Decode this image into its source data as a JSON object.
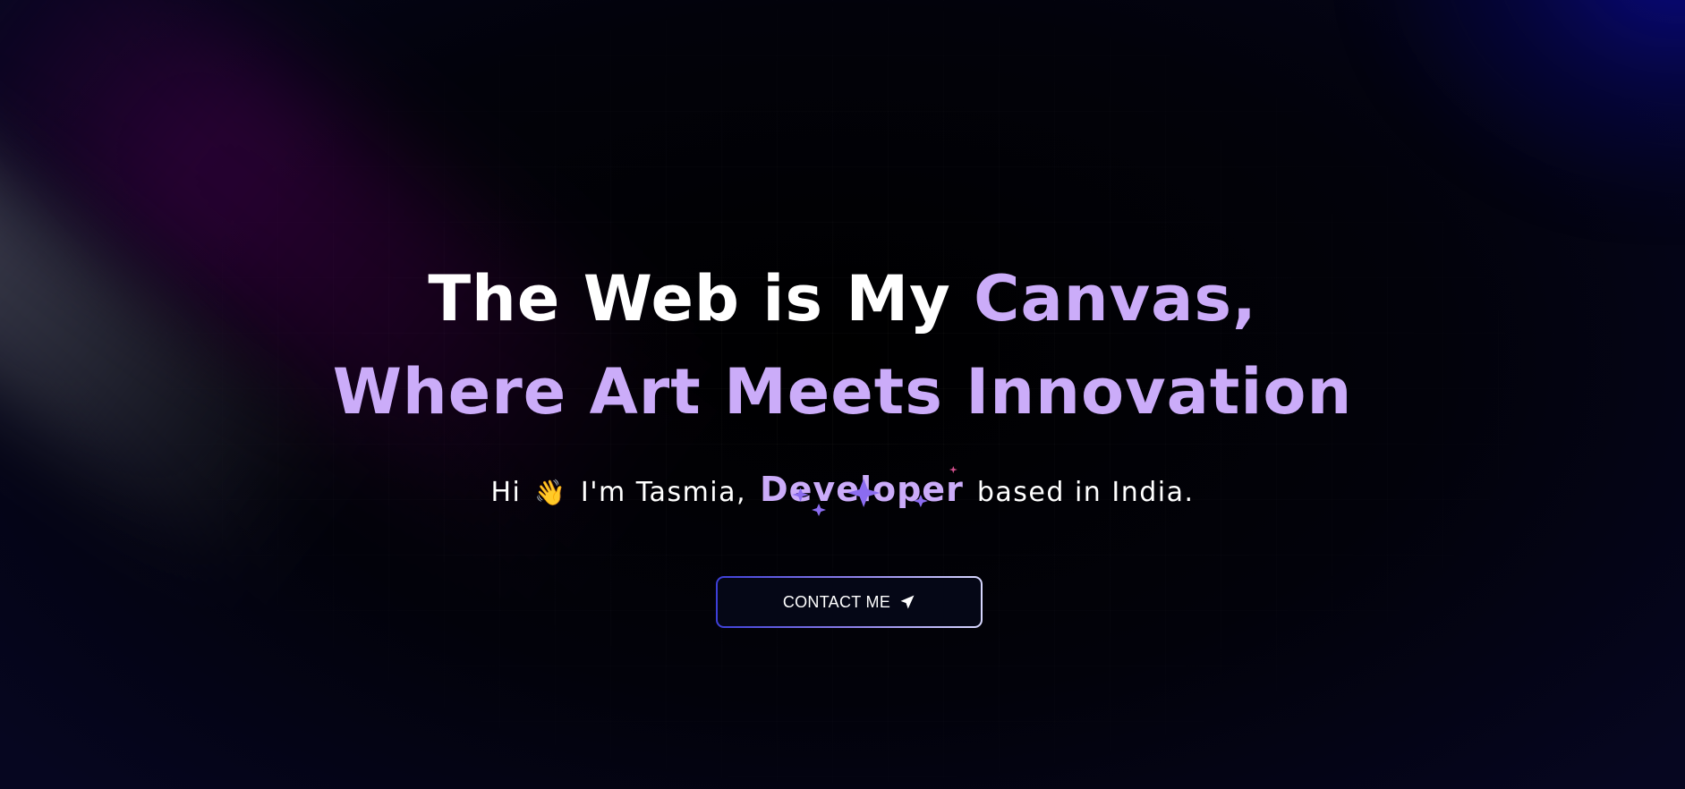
{
  "hero": {
    "headline": {
      "part1": "The Web is My ",
      "part2": "Canvas,",
      "line2": "Where Art Meets Innovation"
    },
    "intro": {
      "greeting": "Hi",
      "wave_icon": "👋",
      "name_text": "I'm Tasmia,",
      "role": "Developer",
      "location_text": "based in India."
    },
    "cta": {
      "label": "CONTACT ME",
      "icon": "send-icon"
    }
  },
  "colors": {
    "background": "#03030b",
    "accent_purple": "#cbacf9",
    "button_bg": "#050716",
    "button_border_start": "#3d3fd8",
    "button_border_end": "#d8d8ff"
  }
}
